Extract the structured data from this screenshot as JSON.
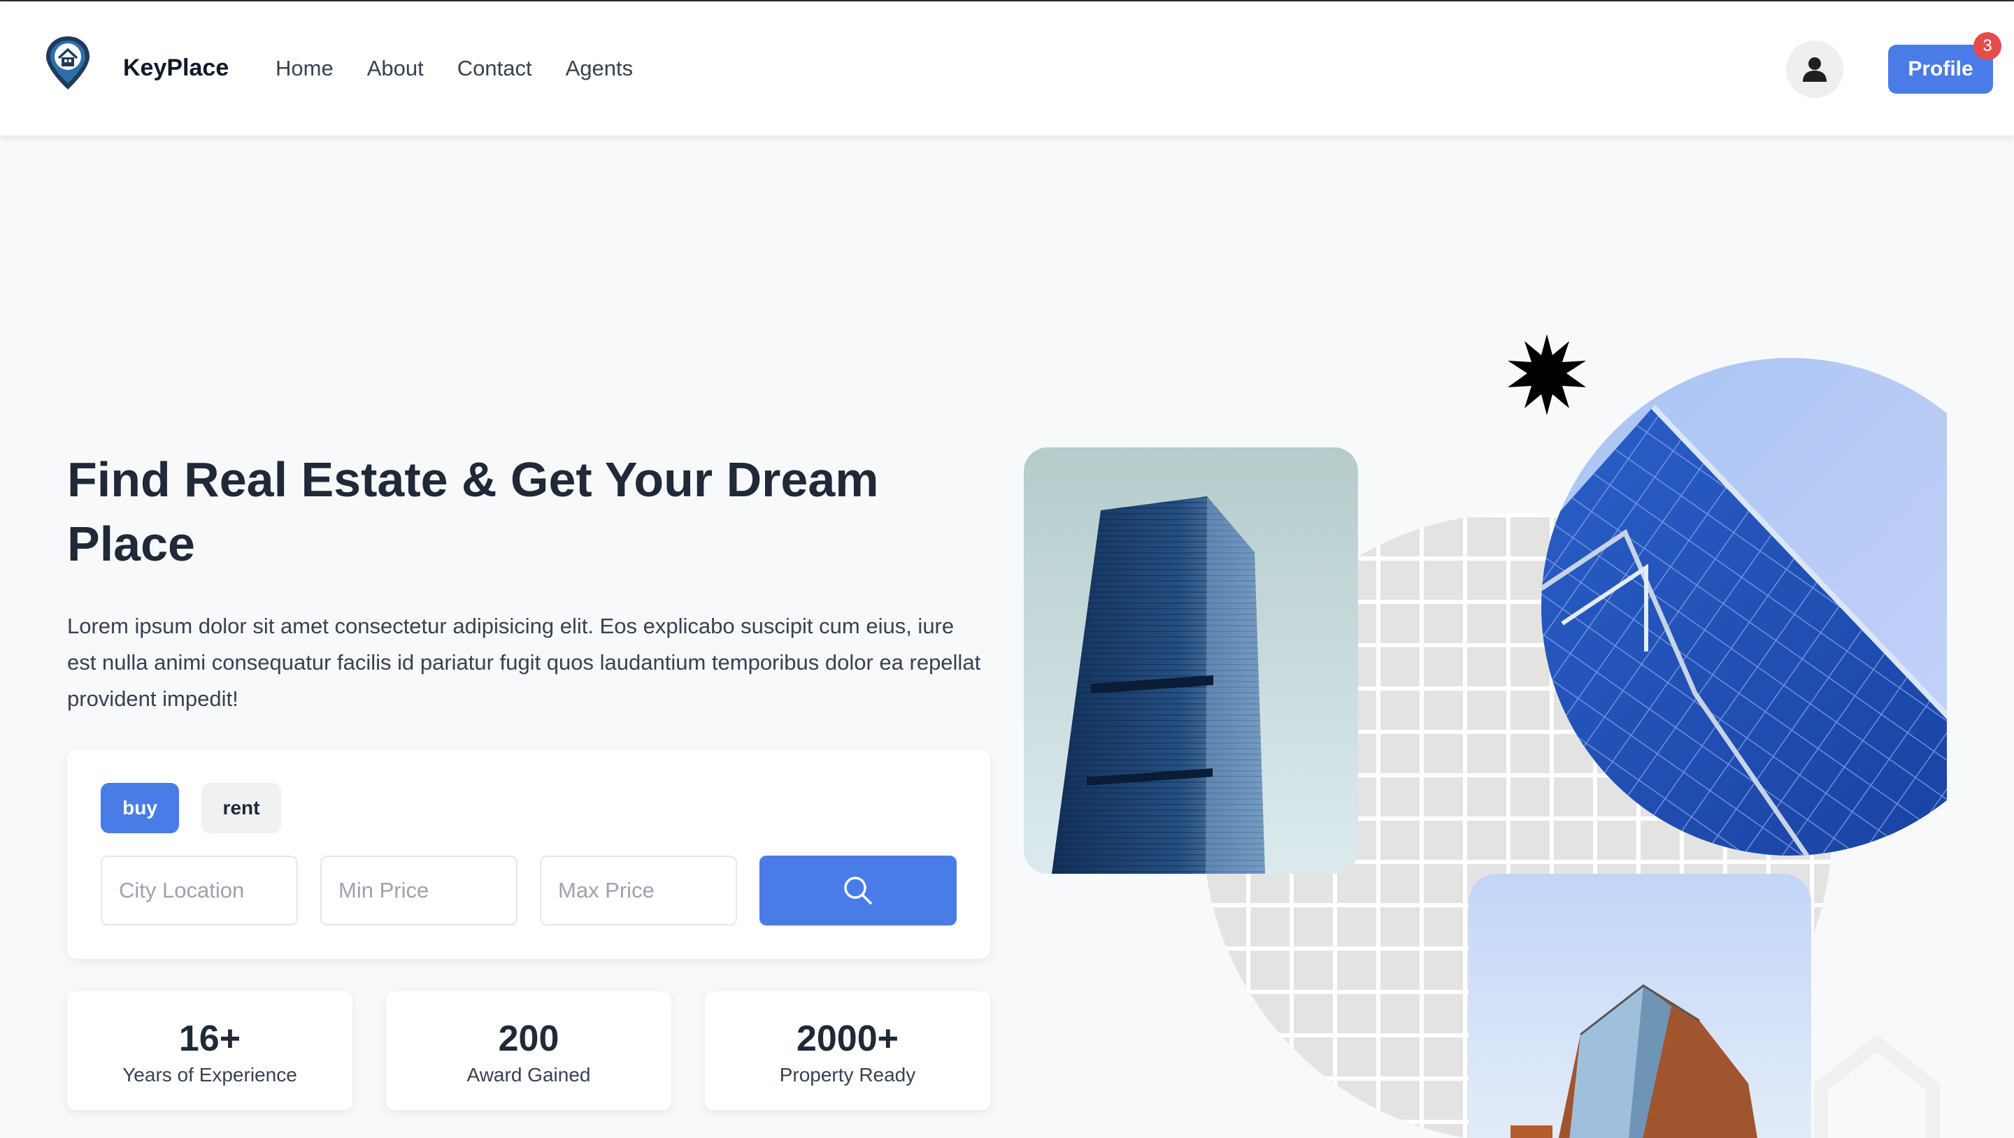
{
  "header": {
    "brand": "KeyPlace",
    "nav": [
      "Home",
      "About",
      "Contact",
      "Agents"
    ],
    "profile_label": "Profile",
    "notification_count": "3",
    "logo_icon": "house-pin-icon",
    "user_icon": "user-icon"
  },
  "hero": {
    "title": "Find Real Estate & Get Your Dream Place",
    "description": "Lorem ipsum dolor sit amet consectetur adipisicing elit. Eos explicabo suscipit cum eius, iure est nulla animi consequatur facilis id pariatur fugit quos laudantium temporibus dolor ea repellat provident impedit!"
  },
  "search": {
    "tabs": [
      "buy",
      "rent"
    ],
    "active_tab": "buy",
    "fields": [
      {
        "placeholder": "City Location",
        "value": ""
      },
      {
        "placeholder": "Min Price",
        "value": ""
      },
      {
        "placeholder": "Max Price",
        "value": ""
      }
    ],
    "button_icon": "search-icon"
  },
  "stats": [
    {
      "value": "16+",
      "label": "Years of Experience"
    },
    {
      "value": "200",
      "label": "Award Gained"
    },
    {
      "value": "2000+",
      "label": "Property Ready"
    }
  ],
  "colors": {
    "accent": "#4a7ce8",
    "badge": "#e54b4b",
    "text_dark": "#1f2937",
    "background": "#f8f9fb"
  }
}
